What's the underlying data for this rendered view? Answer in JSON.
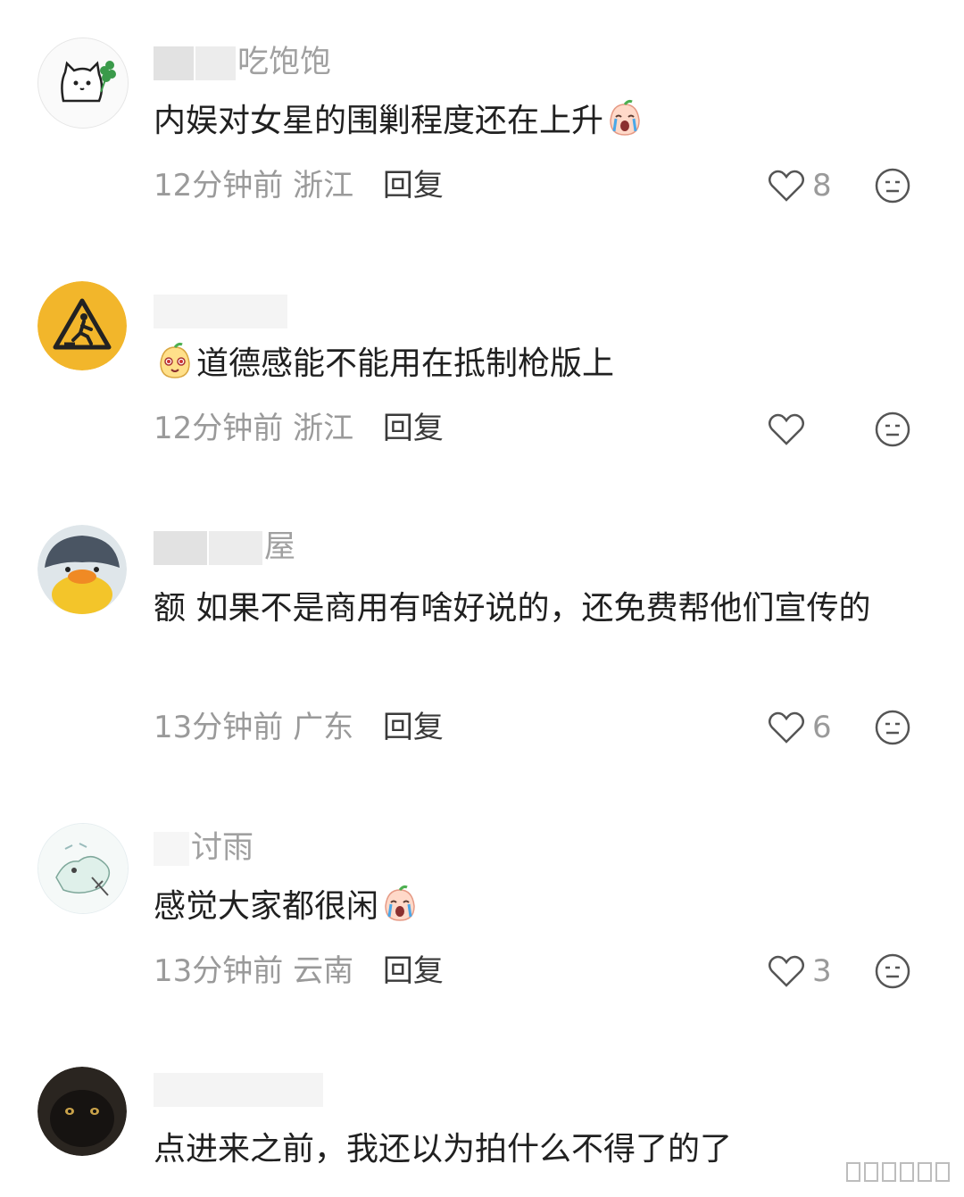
{
  "comments": [
    {
      "username_visible": "吃饱饱",
      "text": "内娱对女星的围剿程度还在上升",
      "emoji": "crying-peach-emoji",
      "time": "12分钟前",
      "location": "浙江",
      "reply_label": "回复",
      "likes": "8",
      "avatar": "cat-clover-avatar"
    },
    {
      "username_visible": "",
      "text": "道德感能不能用在抵制枪版上",
      "emoji": "peach-face-emoji",
      "time": "12分钟前",
      "location": "浙江",
      "reply_label": "回复",
      "likes": "",
      "avatar": "caution-sign-avatar"
    },
    {
      "username_visible": "屋",
      "text": "额 如果不是商用有啥好说的，还免费帮他们宣传的",
      "emoji": "",
      "time": "13分钟前",
      "location": "广东",
      "reply_label": "回复",
      "likes": "6",
      "avatar": "duck-hat-avatar"
    },
    {
      "username_visible": "讨雨",
      "text": "感觉大家都很闲",
      "emoji": "crying-peach-emoji",
      "time": "13分钟前",
      "location": "云南",
      "reply_label": "回复",
      "likes": "3",
      "avatar": "sketch-avatar"
    },
    {
      "username_visible": "",
      "text": "点进来之前，我还以为拍什么不得了的了",
      "emoji": "",
      "time": "",
      "location": "",
      "reply_label": "",
      "likes": "",
      "avatar": "black-cat-avatar"
    }
  ],
  "colors": {
    "text": "#202020",
    "meta": "#9a9a9a",
    "reply": "#3a3a3a",
    "caution_yellow": "#f2b62b"
  }
}
